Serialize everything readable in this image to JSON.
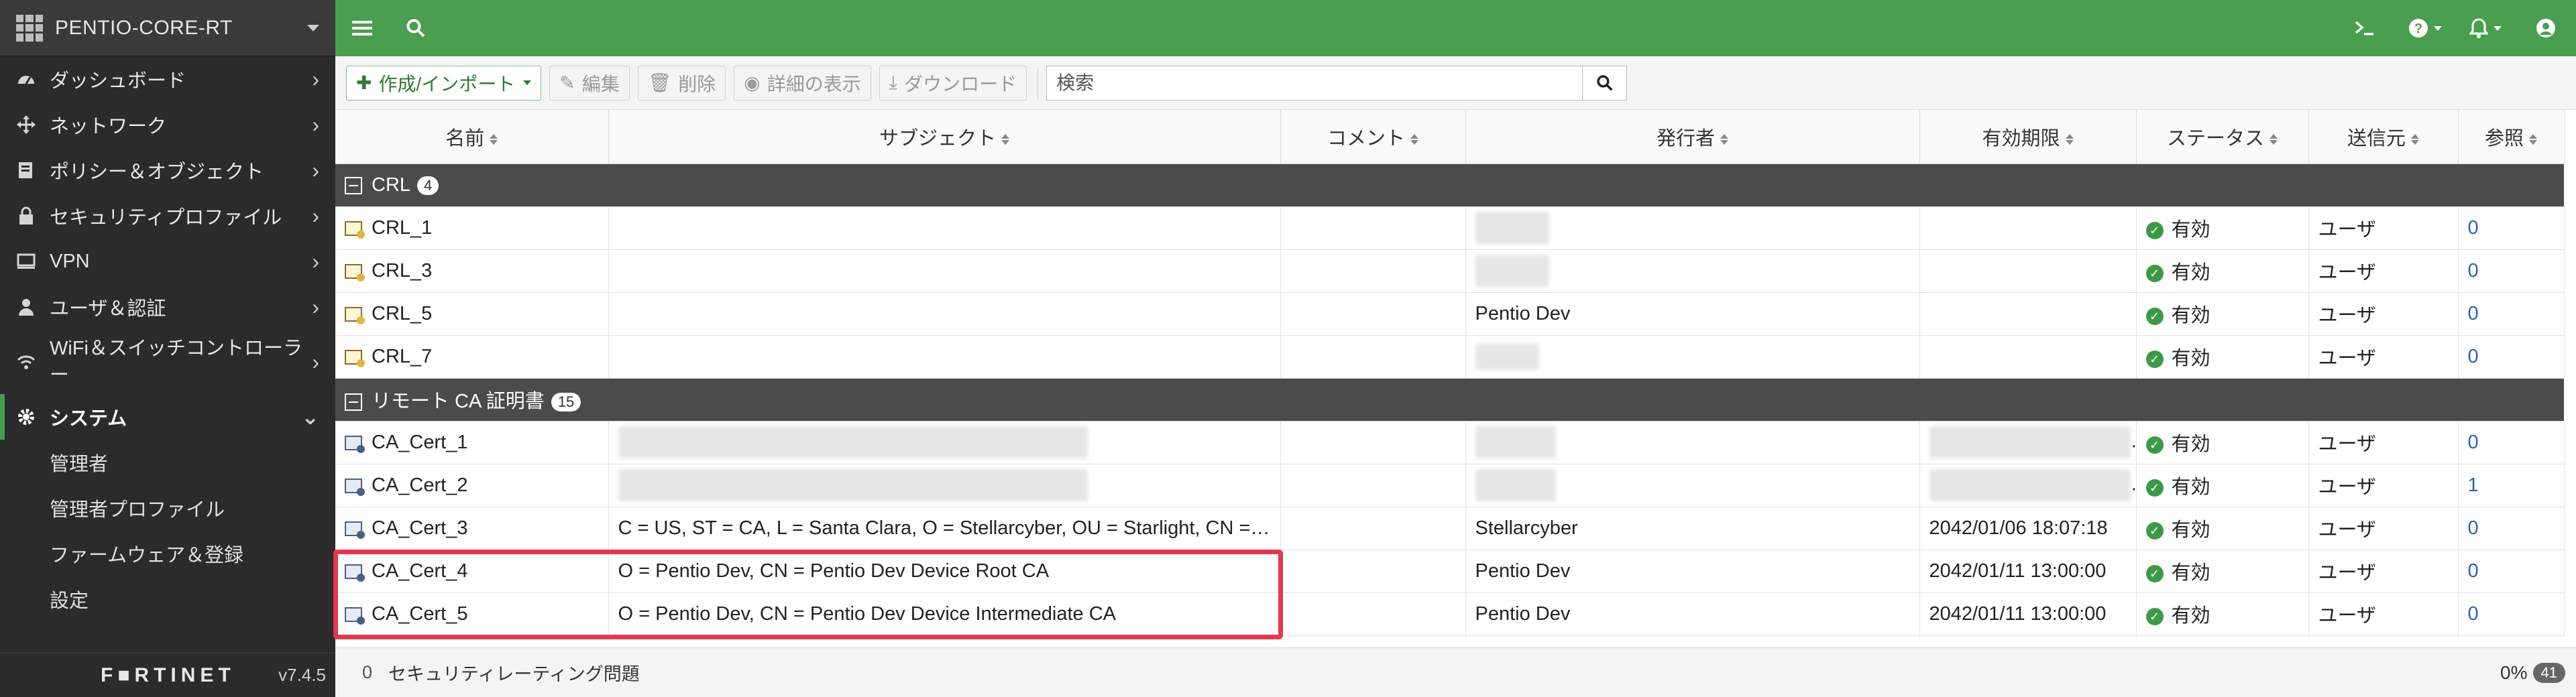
{
  "sidebar": {
    "host": "PENTIO-CORE-RT",
    "items": [
      {
        "label": "ダッシュボード",
        "icon": "dashboard-icon"
      },
      {
        "label": "ネットワーク",
        "icon": "network-icon"
      },
      {
        "label": "ポリシー＆オブジェクト",
        "icon": "policy-icon"
      },
      {
        "label": "セキュリティプロファイル",
        "icon": "lock-icon"
      },
      {
        "label": "VPN",
        "icon": "monitor-icon"
      },
      {
        "label": "ユーザ＆認証",
        "icon": "user-icon"
      },
      {
        "label": "WiFi＆スイッチコントローラー",
        "icon": "wifi-icon"
      },
      {
        "label": "システム",
        "icon": "gear-icon"
      }
    ],
    "subitems": [
      "管理者",
      "管理者プロファイル",
      "ファームウェア＆登録",
      "設定"
    ],
    "brand": "F■RTINET",
    "version": "v7.4.5"
  },
  "toolbar": {
    "create": "作成/インポート",
    "edit": "編集",
    "delete": "削除",
    "details": "詳細の表示",
    "download": "ダウンロード",
    "search_placeholder": "検索"
  },
  "table": {
    "columns": [
      "名前",
      "サブジェクト",
      "コメント",
      "発行者",
      "有効期限",
      "ステータス",
      "送信元",
      "参照"
    ],
    "groups": [
      {
        "label": "CRL",
        "count": "4",
        "rows": [
          {
            "name": "CRL_1",
            "subject": "",
            "comment": "",
            "issuer": "",
            "expiry": "",
            "status": "有効",
            "source": "ユーザ",
            "ref": "0"
          },
          {
            "name": "CRL_3",
            "subject": "",
            "comment": "",
            "issuer": "",
            "expiry": "",
            "status": "有効",
            "source": "ユーザ",
            "ref": "0"
          },
          {
            "name": "CRL_5",
            "subject": "",
            "comment": "",
            "issuer": "Pentio Dev",
            "expiry": "",
            "status": "有効",
            "source": "ユーザ",
            "ref": "0"
          },
          {
            "name": "CRL_7",
            "subject": "",
            "comment": "",
            "issuer": "",
            "expiry": "",
            "status": "有効",
            "source": "ユーザ",
            "ref": "0"
          }
        ]
      },
      {
        "label": "リモート CA 証明書",
        "count": "15",
        "rows": [
          {
            "name": "CA_Cert_1",
            "subject": "",
            "comment": "",
            "issuer": "",
            "expiry": "",
            "status": "有効",
            "source": "ユーザ",
            "ref": "0"
          },
          {
            "name": "CA_Cert_2",
            "subject": "",
            "comment": "",
            "issuer": "",
            "expiry": "",
            "status": "有効",
            "source": "ユーザ",
            "ref": "1"
          },
          {
            "name": "CA_Cert_3",
            "subject": "C = US, ST = CA, L = Santa Clara, O = Stellarcyber, OU = Starlight, CN = St...",
            "comment": "",
            "issuer": "Stellarcyber",
            "expiry": "2042/01/06 18:07:18",
            "status": "有効",
            "source": "ユーザ",
            "ref": "0"
          },
          {
            "name": "CA_Cert_4",
            "subject": "O = Pentio Dev, CN = Pentio Dev Device Root CA",
            "comment": "",
            "issuer": "Pentio Dev",
            "expiry": "2042/01/11 13:00:00",
            "status": "有効",
            "source": "ユーザ",
            "ref": "0"
          },
          {
            "name": "CA_Cert_5",
            "subject": "O = Pentio Dev, CN = Pentio Dev Device Intermediate CA",
            "comment": "",
            "issuer": "Pentio Dev",
            "expiry": "2042/01/11 13:00:00",
            "status": "有効",
            "source": "ユーザ",
            "ref": "0"
          }
        ]
      }
    ]
  },
  "footer": {
    "count": "0",
    "label": "セキュリティレーティング問題",
    "percent": "0%",
    "badge": "41"
  },
  "colors": {
    "topbar": "#4a9e4f",
    "sidebar": "#2b2b2b",
    "highlight": "#e8374c",
    "status_ok": "#3c9a45"
  }
}
